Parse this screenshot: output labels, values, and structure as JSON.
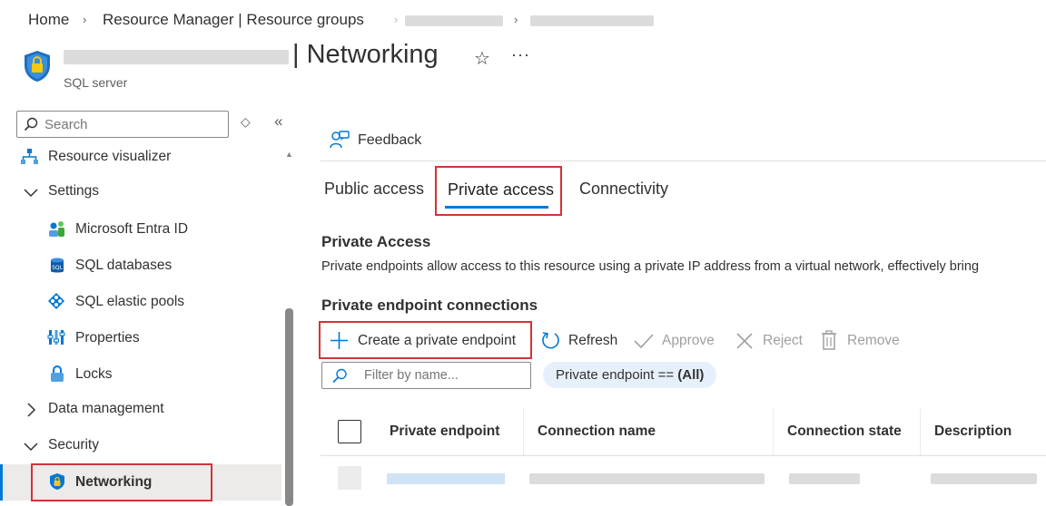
{
  "breadcrumb": {
    "home": "Home",
    "resource_groups": "Resource Manager | Resource groups"
  },
  "header": {
    "title": "| Networking",
    "subtitle": "SQL server",
    "star_icon": "star-icon",
    "more_icon": "ellipsis-icon"
  },
  "sidebar": {
    "search_placeholder": "Search",
    "items": [
      {
        "label": "Resource visualizer",
        "icon": "resource-visualizer-icon"
      },
      {
        "label": "Settings",
        "icon": "chevron-down-icon"
      },
      {
        "label": "Microsoft Entra ID",
        "icon": "entra-id-icon"
      },
      {
        "label": "SQL databases",
        "icon": "sql-database-icon"
      },
      {
        "label": "SQL elastic pools",
        "icon": "elastic-pool-icon"
      },
      {
        "label": "Properties",
        "icon": "properties-icon"
      },
      {
        "label": "Locks",
        "icon": "lock-icon"
      },
      {
        "label": "Data management",
        "icon": "chevron-right-icon"
      },
      {
        "label": "Security",
        "icon": "chevron-down-icon"
      },
      {
        "label": "Networking",
        "icon": "shield-icon"
      }
    ]
  },
  "toolbar": {
    "feedback": "Feedback"
  },
  "tabs": [
    {
      "label": "Public access"
    },
    {
      "label": "Private access"
    },
    {
      "label": "Connectivity"
    }
  ],
  "private_access": {
    "heading": "Private Access",
    "description": "Private endpoints allow access to this resource using a private IP address from a virtual network, effectively bring"
  },
  "endpoints": {
    "heading": "Private endpoint connections",
    "commands": {
      "create": "Create a private endpoint",
      "refresh": "Refresh",
      "approve": "Approve",
      "reject": "Reject",
      "remove": "Remove"
    },
    "filter_placeholder": "Filter by name...",
    "filter_pill_prefix": "Private endpoint ==",
    "filter_pill_value": "(All)",
    "columns": [
      "Private endpoint",
      "Connection name",
      "Connection state",
      "Description"
    ]
  },
  "colors": {
    "accent": "#0078d4",
    "highlight_box": "#d13438"
  }
}
